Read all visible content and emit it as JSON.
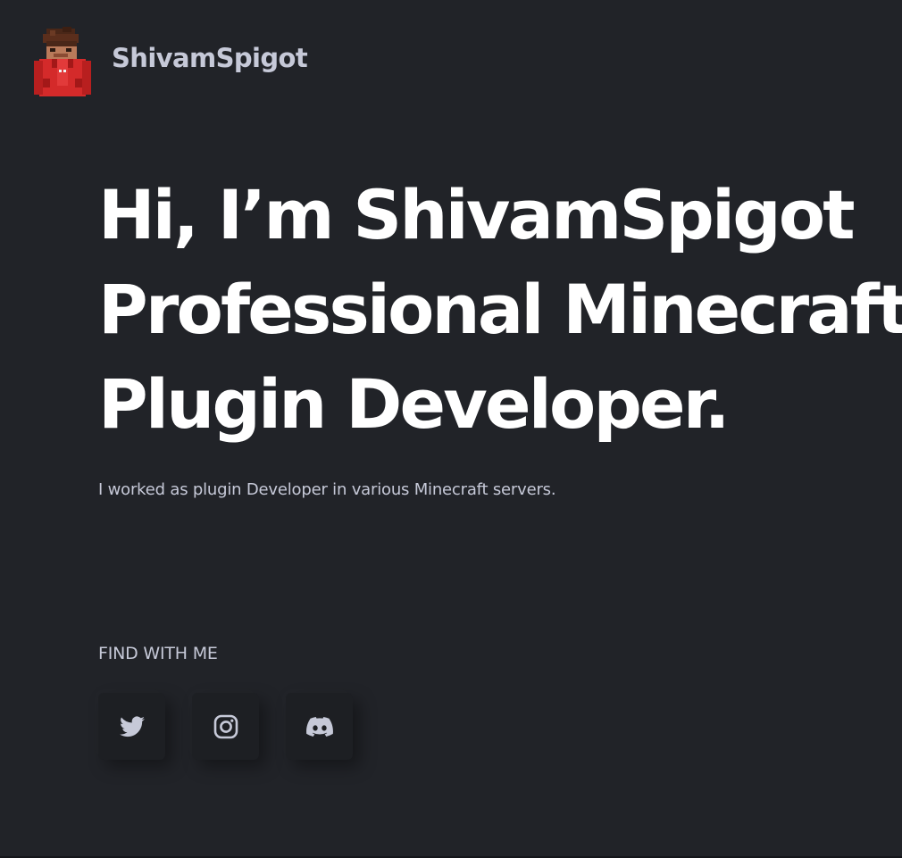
{
  "header": {
    "brand_name": "ShivamSpigot",
    "avatar_icon": "minecraft-skin-avatar"
  },
  "hero": {
    "line1": "Hi, I’m ShivamSpigot",
    "line2": "Professional Minecraft",
    "line3": "Plugin Developer.",
    "subtitle": "I worked as plugin Developer in various Minecraft servers."
  },
  "social": {
    "title": "FIND WITH ME",
    "items": [
      {
        "icon": "twitter-icon"
      },
      {
        "icon": "instagram-icon"
      },
      {
        "icon": "discord-icon"
      }
    ]
  },
  "colors": {
    "background": "#212328",
    "heading": "#ffffff",
    "body_text": "#c6c9d8",
    "button_bg": "#1d1f23",
    "avatar_red": "#d42a2a"
  }
}
